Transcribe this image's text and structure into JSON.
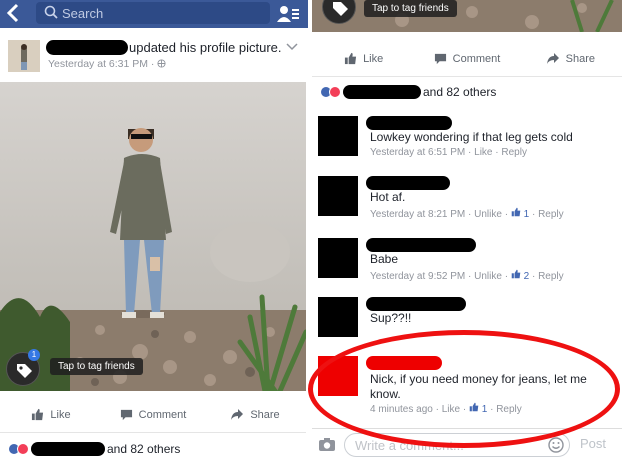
{
  "left": {
    "search": {
      "placeholder": "Search"
    },
    "post": {
      "title": "updated his profile picture.",
      "timestamp": "Yesterday at 6:31 PM · ",
      "privacy_icon": "globe-icon"
    },
    "tag_tip": "Tap to tag friends",
    "tag_badge": "1",
    "actions": {
      "like": "Like",
      "comment": "Comment",
      "share": "Share"
    },
    "reactions": {
      "others": "and 82 others"
    }
  },
  "right": {
    "tag_tip": "Tap to tag friends",
    "actions": {
      "like": "Like",
      "comment": "Comment",
      "share": "Share"
    },
    "reactions": {
      "others": "and 82 others"
    },
    "comments": [
      {
        "text": "Lowkey wondering if that leg gets cold",
        "time": "Yesterday at 6:51 PM",
        "like": "Like",
        "reply": "Reply"
      },
      {
        "text": "Hot af.",
        "time": "Yesterday at 8:21 PM",
        "like": "Unlike",
        "count": "1",
        "reply": "Reply"
      },
      {
        "text": "Babe",
        "time": "Yesterday at 9:52 PM",
        "like": "Unlike",
        "count": "2",
        "reply": "Reply"
      },
      {
        "text": "Sup??!!",
        "time": "",
        "like": "",
        "reply": ""
      },
      {
        "text": "Nick, if you need money for jeans, let me know.",
        "time": "4 minutes ago",
        "like": "Like",
        "count": "1",
        "reply": "Reply"
      }
    ],
    "composer": {
      "placeholder": "Write a comment...",
      "post": "Post"
    }
  },
  "colors": {
    "brand": "#3b5998",
    "link": "#4267b2",
    "annotation": "#ee1111"
  }
}
